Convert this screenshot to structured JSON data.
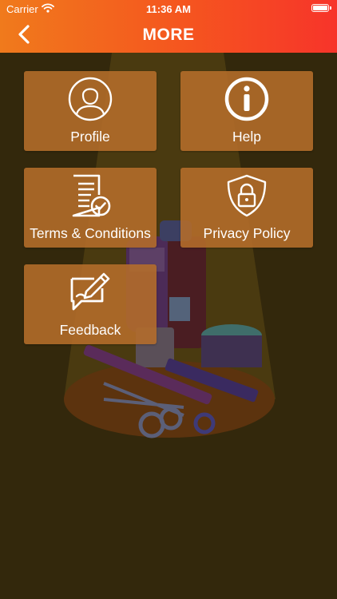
{
  "status_bar": {
    "carrier": "Carrier",
    "time": "11:36 AM"
  },
  "header": {
    "title": "MORE",
    "back_icon": "chevron-left-icon"
  },
  "colors": {
    "header_start": "#f07a1c",
    "header_end": "#f7342a",
    "tile": "#b56d2a",
    "background": "#33280c"
  },
  "menu": [
    {
      "label": "Profile",
      "icon": "user-icon"
    },
    {
      "label": "Help",
      "icon": "info-icon"
    },
    {
      "label": "Terms & Conditions",
      "icon": "document-check-icon"
    },
    {
      "label": "Privacy Policy",
      "icon": "shield-lock-icon"
    },
    {
      "label": "Feedback",
      "icon": "feedback-edit-icon"
    }
  ]
}
